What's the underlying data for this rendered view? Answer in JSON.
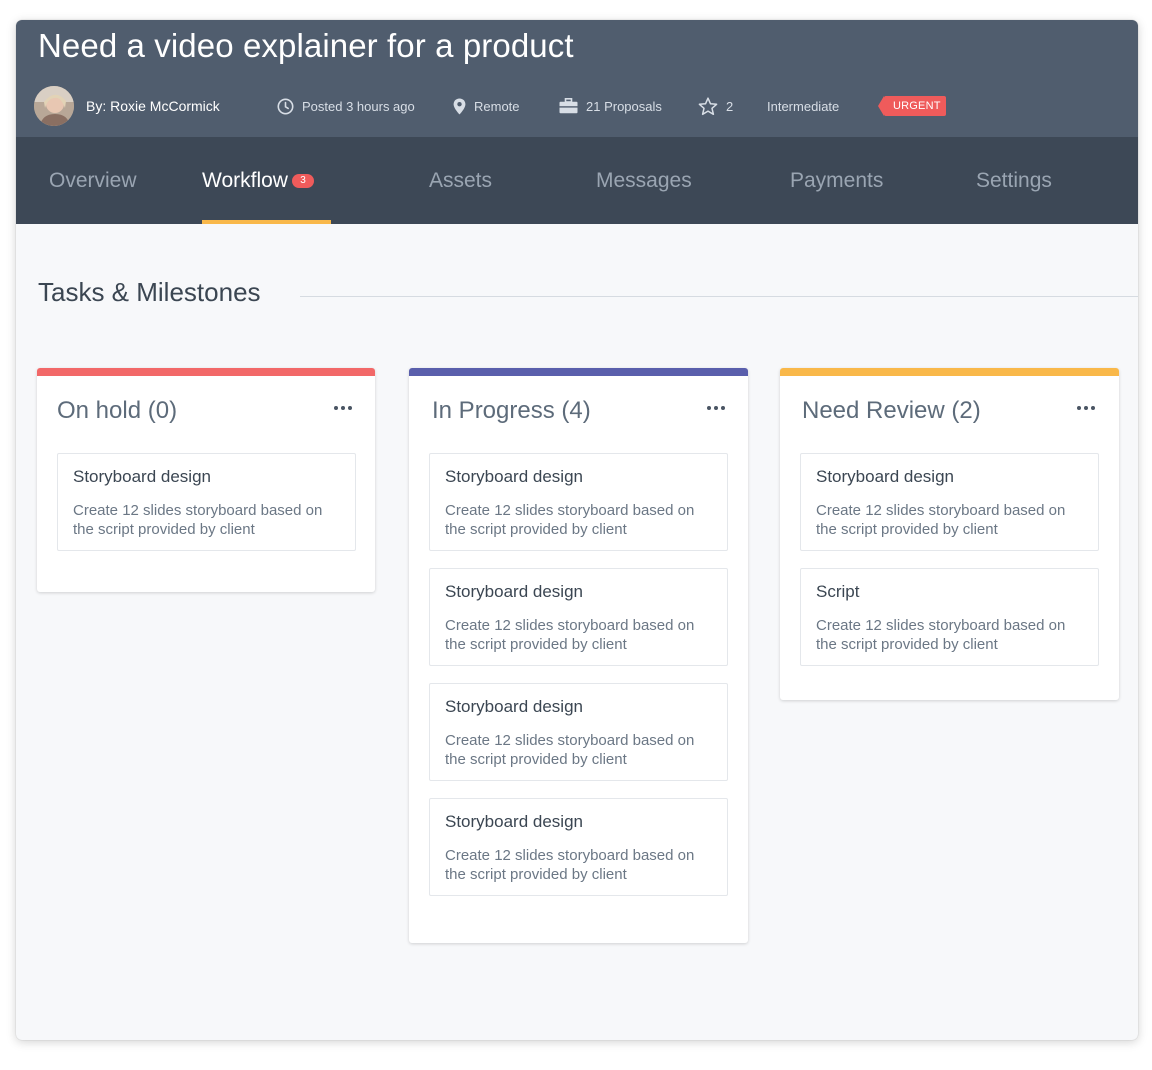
{
  "job": {
    "title": "Need a video explainer for a product",
    "author": "By: Roxie McCormick",
    "posted": "Posted 3 hours ago",
    "location": "Remote",
    "proposals": "21 Proposals",
    "stars": "2",
    "level": "Intermediate",
    "urgent": "URGENT"
  },
  "tabs": [
    {
      "label": "Overview"
    },
    {
      "label": "Workflow",
      "badge": "3",
      "active": true
    },
    {
      "label": "Assets"
    },
    {
      "label": "Messages"
    },
    {
      "label": "Payments"
    },
    {
      "label": "Settings"
    }
  ],
  "section": {
    "title": "Tasks & Milestones"
  },
  "columns": [
    {
      "title": "On hold (0)",
      "color": "#f26868",
      "cards": [
        {
          "title": "Storyboard design",
          "desc": "Create 12 slides storyboard based on the script provided by client"
        }
      ]
    },
    {
      "title": "In Progress (4)",
      "color": "#5a5fac",
      "cards": [
        {
          "title": "Storyboard design",
          "desc": "Create 12 slides storyboard based on the script provided by client"
        },
        {
          "title": "Storyboard design",
          "desc": "Create 12 slides storyboard based on the script provided by client"
        },
        {
          "title": "Storyboard design",
          "desc": "Create 12 slides storyboard based on the script provided by client"
        },
        {
          "title": "Storyboard design",
          "desc": "Create 12 slides storyboard based on the script provided by client"
        }
      ]
    },
    {
      "title": "Need Review (2)",
      "color": "#f9b84a",
      "cards": [
        {
          "title": "Storyboard design",
          "desc": "Create 12 slides storyboard based on the script provided by client"
        },
        {
          "title": "Script",
          "desc": "Create 12 slides storyboard based on the script provided by client"
        }
      ]
    }
  ],
  "colors": {
    "header_bg": "#505d6e",
    "tabs_bg": "#3d4856",
    "active_tab_underline": "#f9b84a",
    "urgent": "#ef5b5b",
    "page_bg": "#f7f8fa"
  },
  "icons": [
    "clock-icon",
    "location-pin-icon",
    "briefcase-icon",
    "star-icon",
    "more-dots-icon"
  ]
}
